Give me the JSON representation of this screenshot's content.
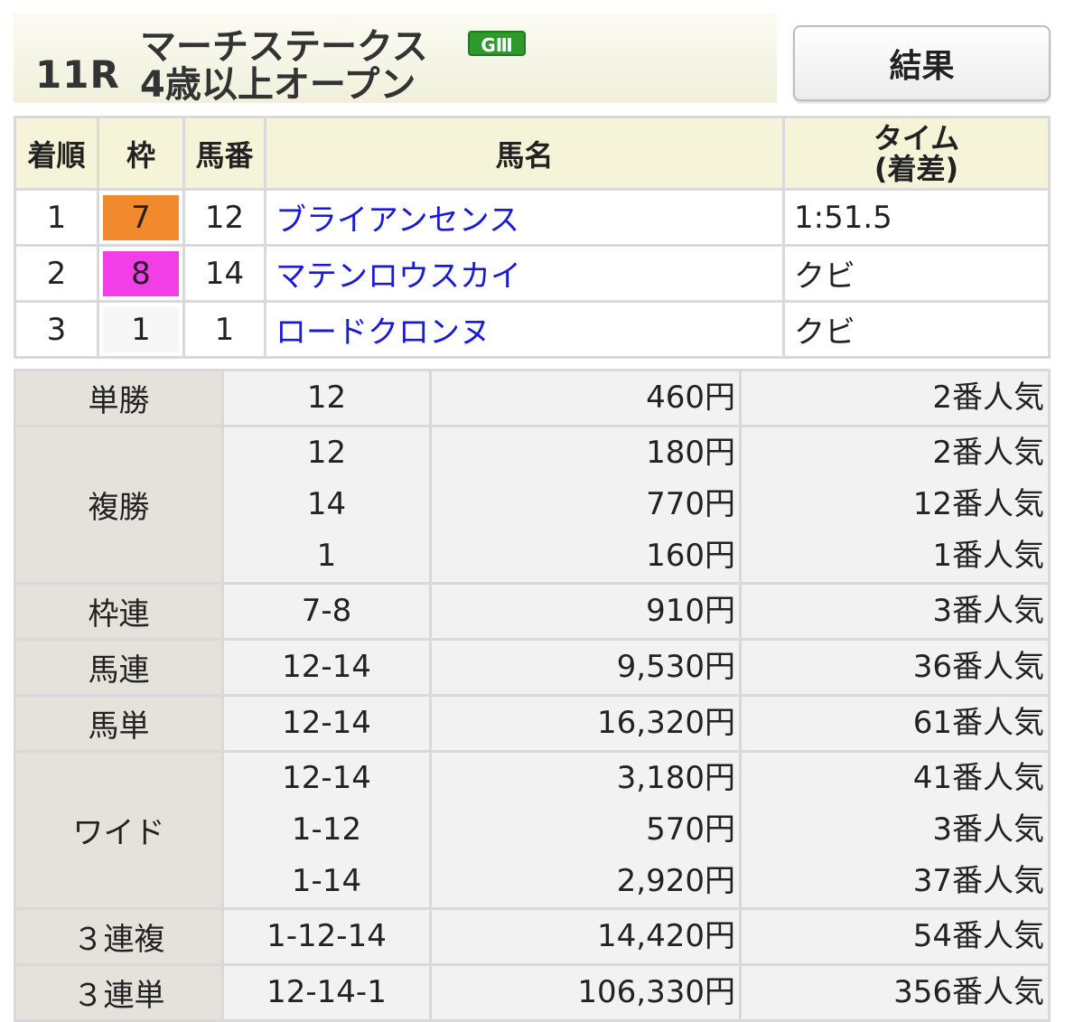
{
  "header": {
    "race_number": "11R",
    "race_name": "マーチステークス",
    "grade": "GⅢ",
    "race_condition": "4歳以上オープン",
    "result_button": "結果"
  },
  "results_table": {
    "headers": {
      "rank": "着順",
      "frame": "枠",
      "horse_number": "馬番",
      "horse_name": "馬名",
      "time_line1": "タイム",
      "time_line2": "(着差)"
    },
    "rows": [
      {
        "rank": "1",
        "frame": "7",
        "frame_bg": "#f08a2c",
        "frame_color": "#222222",
        "horse_number": "12",
        "horse_name": "ブライアンセンス",
        "time": "1:51.5"
      },
      {
        "rank": "2",
        "frame": "8",
        "frame_bg": "#f23ee6",
        "frame_color": "#222222",
        "horse_number": "14",
        "horse_name": "マテンロウスカイ",
        "time": "クビ"
      },
      {
        "rank": "3",
        "frame": "1",
        "frame_bg": "#f7f7f7",
        "frame_color": "#222222",
        "horse_number": "1",
        "horse_name": "ロードクロンヌ",
        "time": "クビ"
      }
    ]
  },
  "payouts": [
    {
      "type": "単勝",
      "entries": [
        {
          "combination": "12",
          "payout": "460円",
          "popularity": "2番人気"
        }
      ]
    },
    {
      "type": "複勝",
      "entries": [
        {
          "combination": "12",
          "payout": "180円",
          "popularity": "2番人気"
        },
        {
          "combination": "14",
          "payout": "770円",
          "popularity": "12番人気"
        },
        {
          "combination": "1",
          "payout": "160円",
          "popularity": "1番人気"
        }
      ]
    },
    {
      "type": "枠連",
      "entries": [
        {
          "combination": "7-8",
          "payout": "910円",
          "popularity": "3番人気"
        }
      ]
    },
    {
      "type": "馬連",
      "entries": [
        {
          "combination": "12-14",
          "payout": "9,530円",
          "popularity": "36番人気"
        }
      ]
    },
    {
      "type": "馬単",
      "entries": [
        {
          "combination": "12-14",
          "payout": "16,320円",
          "popularity": "61番人気"
        }
      ]
    },
    {
      "type": "ワイド",
      "entries": [
        {
          "combination": "12-14",
          "payout": "3,180円",
          "popularity": "41番人気"
        },
        {
          "combination": "1-12",
          "payout": "570円",
          "popularity": "3番人気"
        },
        {
          "combination": "1-14",
          "payout": "2,920円",
          "popularity": "37番人気"
        }
      ]
    },
    {
      "type": "３連複",
      "entries": [
        {
          "combination": "1-12-14",
          "payout": "14,420円",
          "popularity": "54番人気"
        }
      ]
    },
    {
      "type": "３連単",
      "entries": [
        {
          "combination": "12-14-1",
          "payout": "106,330円",
          "popularity": "356番人気"
        }
      ]
    }
  ]
}
